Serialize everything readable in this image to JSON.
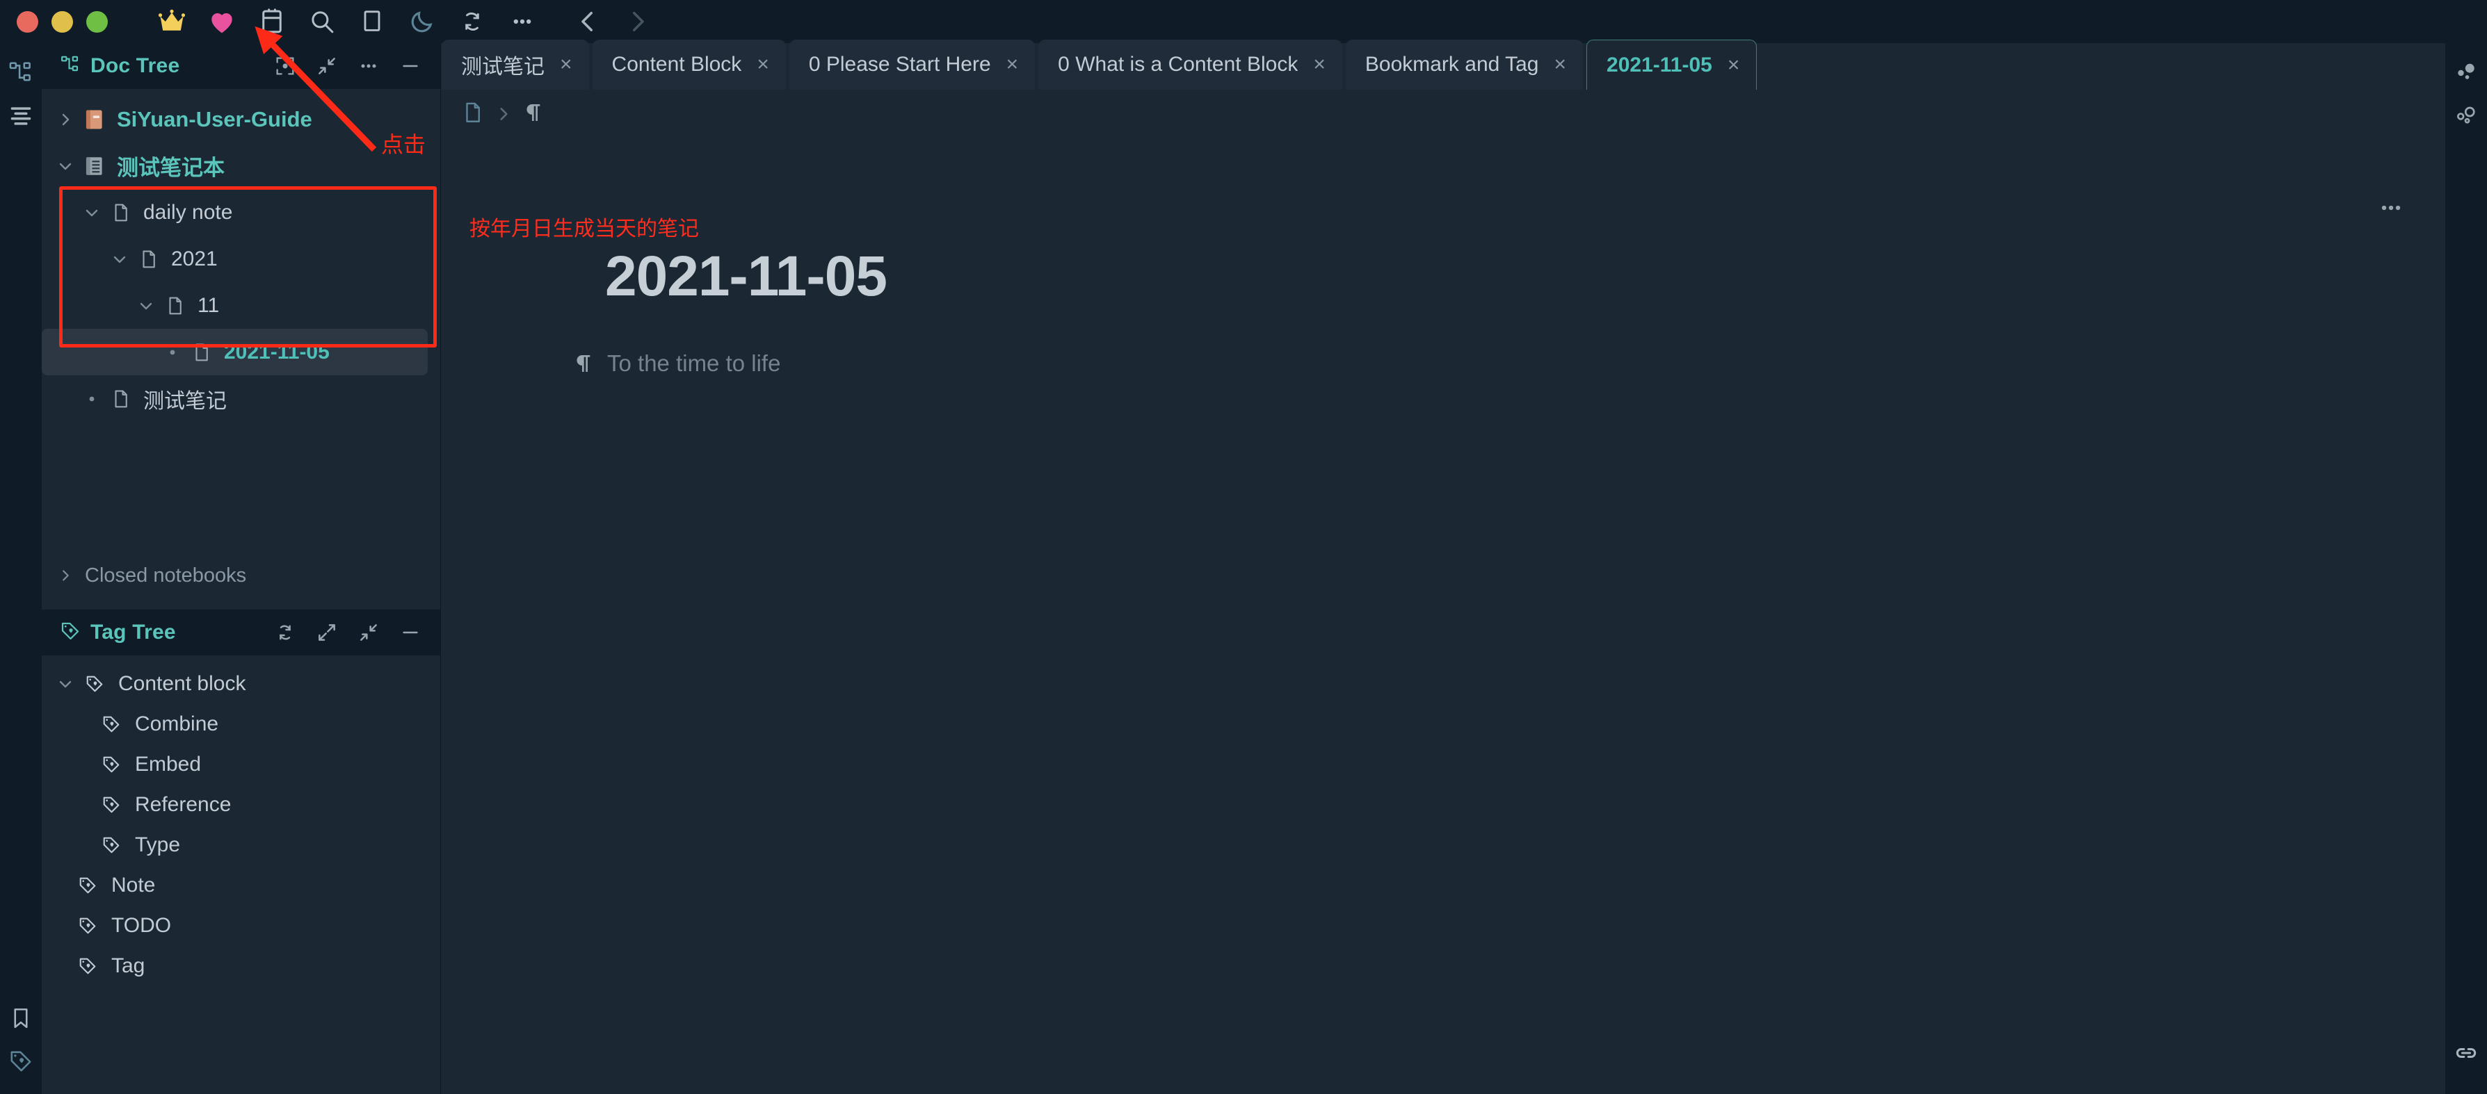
{
  "window": {
    "traffic_lights": [
      {
        "name": "close",
        "color": "#e8695e"
      },
      {
        "name": "minimize",
        "color": "#e0c04a"
      },
      {
        "name": "maximize",
        "color": "#6fbf44"
      }
    ]
  },
  "toolbar": {
    "items": [
      {
        "icon": "crown-icon",
        "label": "VIP"
      },
      {
        "icon": "heart-icon",
        "label": "Sponsor"
      },
      {
        "icon": "calendar-icon",
        "label": "Daily Note"
      },
      {
        "icon": "search-icon",
        "label": "Search"
      },
      {
        "icon": "card-icon",
        "label": "Flashcard"
      },
      {
        "icon": "moon-icon",
        "label": "Theme Mode"
      },
      {
        "icon": "sync-icon",
        "label": "Sync"
      },
      {
        "icon": "more-icon",
        "label": "More"
      },
      {
        "icon": "chevron-left-icon",
        "label": "Back"
      },
      {
        "icon": "chevron-right-icon",
        "label": "Forward"
      }
    ]
  },
  "dock_left": {
    "top_items": [
      {
        "icon": "doc-tree-icon",
        "label": "Doc Tree",
        "active": true
      },
      {
        "icon": "outline-icon",
        "label": "Outline",
        "active": false
      }
    ],
    "bottom_items": [
      {
        "icon": "bookmark-icon",
        "label": "Bookmark",
        "active": false
      },
      {
        "icon": "tag-icon",
        "label": "Tag",
        "active": true
      }
    ]
  },
  "dock_right": {
    "top_items": [
      {
        "icon": "graph-icon",
        "label": "Graph View",
        "active": false
      },
      {
        "icon": "global-graph-icon",
        "label": "Global Graph",
        "active": false
      }
    ],
    "bottom_items": [
      {
        "icon": "backlink-icon",
        "label": "Backlinks",
        "active": false
      }
    ]
  },
  "doc_tree": {
    "title": "Doc Tree",
    "title_icon": "doc-tree-icon",
    "actions": [
      {
        "icon": "focus-icon",
        "label": "Focus"
      },
      {
        "icon": "collapse-icon",
        "label": "Collapse"
      },
      {
        "icon": "more-icon",
        "label": "More"
      },
      {
        "icon": "minimize-icon",
        "label": "Minimize"
      }
    ],
    "items": [
      {
        "label": "SiYuan-User-Guide",
        "type": "notebook",
        "icon": "notebook-book-icon",
        "arrow": "right",
        "depth": 0,
        "selected": false
      },
      {
        "label": "测试笔记本",
        "type": "notebook",
        "icon": "notebook-gray-icon",
        "arrow": "down",
        "depth": 0,
        "selected": false
      },
      {
        "label": "daily note",
        "type": "doc",
        "icon": "file-icon",
        "arrow": "down",
        "depth": 1,
        "selected": false
      },
      {
        "label": "2021",
        "type": "doc",
        "icon": "file-icon",
        "arrow": "down",
        "depth": 2,
        "selected": false
      },
      {
        "label": "11",
        "type": "doc",
        "icon": "file-icon",
        "arrow": "down",
        "depth": 3,
        "selected": false
      },
      {
        "label": "2021-11-05",
        "type": "doc",
        "icon": "file-icon",
        "arrow": "dot",
        "depth": 4,
        "selected": true
      },
      {
        "label": "测试笔记",
        "type": "doc",
        "icon": "file-icon",
        "arrow": "dot",
        "depth": 1,
        "selected": false
      }
    ],
    "closed_notebooks": "Closed notebooks"
  },
  "tag_tree": {
    "title": "Tag Tree",
    "title_icon": "tag-icon",
    "actions": [
      {
        "icon": "refresh-icon",
        "label": "Refresh"
      },
      {
        "icon": "expand-icon",
        "label": "Expand"
      },
      {
        "icon": "collapse-icon",
        "label": "Collapse"
      },
      {
        "icon": "minimize-icon",
        "label": "Minimize"
      }
    ],
    "items": [
      {
        "label": "Content block",
        "depth": 0,
        "arrow": "down"
      },
      {
        "label": "Combine",
        "depth": 1,
        "arrow": "none"
      },
      {
        "label": "Embed",
        "depth": 1,
        "arrow": "none"
      },
      {
        "label": "Reference",
        "depth": 1,
        "arrow": "none"
      },
      {
        "label": "Type",
        "depth": 1,
        "arrow": "none"
      },
      {
        "label": "Note",
        "depth": 0,
        "arrow": "none"
      },
      {
        "label": "TODO",
        "depth": 0,
        "arrow": "none"
      },
      {
        "label": "Tag",
        "depth": 0,
        "arrow": "none"
      }
    ]
  },
  "tabs": [
    {
      "label": "测试笔记",
      "active": false
    },
    {
      "label": "Content Block",
      "active": false
    },
    {
      "label": "0 Please Start Here",
      "active": false
    },
    {
      "label": "0 What is a Content Block",
      "active": false
    },
    {
      "label": "Bookmark and Tag",
      "active": false
    },
    {
      "label": "2021-11-05",
      "active": true
    }
  ],
  "tab_close_glyph": "×",
  "editor": {
    "breadcrumb": [
      {
        "icon": "file-icon",
        "label": ""
      },
      {
        "icon": "paragraph-icon",
        "label": ""
      }
    ],
    "more_label": "•••",
    "doc_title": "2021-11-05",
    "paragraph_mark": "¶",
    "paragraph_text": "To the time to life"
  },
  "annotations": {
    "red_note_top": "按年月日生成当天的笔记",
    "click_label": "点击",
    "box_color": "#fc2a17",
    "arrow_color": "#fc2a17"
  },
  "colors": {
    "accent": "#5bc5bc",
    "bg_main": "#1b2733",
    "bg_dock": "#0f1c27",
    "bg_tab": "#202c39",
    "text_primary": "#c3cbd4",
    "text_muted": "#8b98a5",
    "selected_row": "#2d3643"
  }
}
